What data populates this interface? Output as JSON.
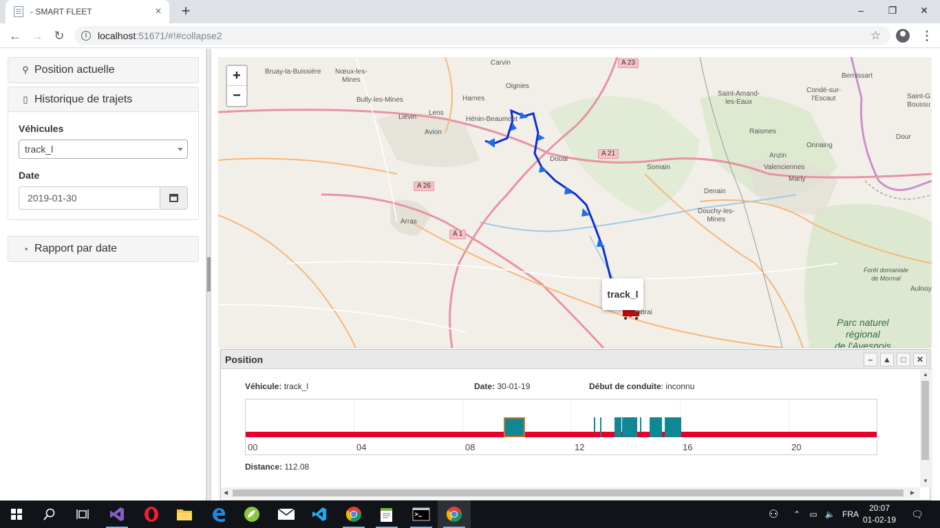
{
  "browser": {
    "tab_title": "- SMART FLEET",
    "url_host": "localhost",
    "url_rest": ":51671/#!#collapse2"
  },
  "sidebar": {
    "position_actuelle": "Position actuelle",
    "historique": "Historique de trajets",
    "vehicules_label": "Véhicules",
    "vehicule_value": "track_l",
    "date_label": "Date",
    "date_value": "2019-01-30",
    "rapport": "Rapport par date"
  },
  "map": {
    "zoom_in": "+",
    "zoom_out": "−",
    "popup_label": "track_l",
    "labels": [
      {
        "text": "Bruay-la-Buissière"
      },
      {
        "text": "Nœux-les-\nMines"
      },
      {
        "text": "Carvin"
      },
      {
        "text": "Oignies"
      },
      {
        "text": "Bully-les-Mines"
      },
      {
        "text": "Lens"
      },
      {
        "text": "Harnes"
      },
      {
        "text": "Liévin"
      },
      {
        "text": "Hénin-Beaumont"
      },
      {
        "text": "Avion"
      },
      {
        "text": "Douai"
      },
      {
        "text": "Somain"
      },
      {
        "text": "Arras"
      },
      {
        "text": "Denain"
      },
      {
        "text": "Douchy-les-\nMines"
      },
      {
        "text": "Raismes"
      },
      {
        "text": "Anzin"
      },
      {
        "text": "Valenciennes"
      },
      {
        "text": "Marly"
      },
      {
        "text": "Onnaing"
      },
      {
        "text": "Saint-Amand-\nles-Eaux"
      },
      {
        "text": "Condé-sur-\nl'Escaut"
      },
      {
        "text": "Bernissart"
      },
      {
        "text": "Saint-G\nBoussu"
      },
      {
        "text": "Dour"
      },
      {
        "text": "Forêt domaniale\nde Mormal"
      },
      {
        "text": "Aulnoy"
      },
      {
        "text": "Cambrai"
      }
    ],
    "roads": [
      "A 23",
      "A 21",
      "A 26",
      "A 1"
    ],
    "park": "Parc naturel\nrégional\nde l'Avesnois"
  },
  "position_window": {
    "title": "Position",
    "vehicule_label": "Véhicule:",
    "vehicule_value": "track_l",
    "date_label": "Date:",
    "date_value": "30-01-19",
    "debut_label": "Début de conduite",
    "debut_value": ": inconnu",
    "distance_label": "Distance:",
    "distance_value": "112.08",
    "ticks": [
      "00",
      "04",
      "08",
      "12",
      "16",
      "20"
    ]
  },
  "taskbar": {
    "lang": "FRA",
    "time": "20:07",
    "date": "01-02-19"
  }
}
